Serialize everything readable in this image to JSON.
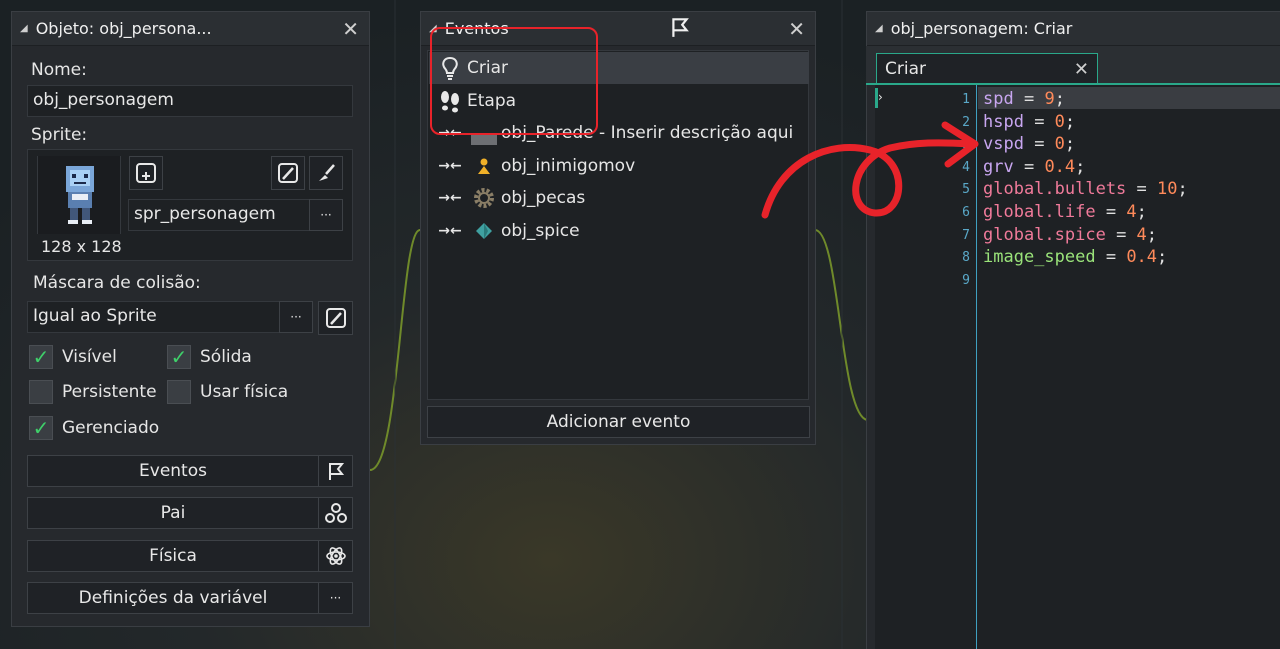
{
  "object_panel": {
    "title": "Objeto: obj_persona...",
    "name_label": "Nome:",
    "name_value": "obj_personagem",
    "sprite_label": "Sprite:",
    "sprite_name": "spr_personagem",
    "sprite_size": "128 x 128",
    "sprite_more": "···",
    "mask_label": "Máscara de colisão:",
    "mask_value": "Igual ao Sprite",
    "mask_more": "···",
    "checks": {
      "visible": {
        "label": "Visível",
        "checked": true
      },
      "solid": {
        "label": "Sólida",
        "checked": true
      },
      "persistent": {
        "label": "Persistente",
        "checked": false
      },
      "physics": {
        "label": "Usar física",
        "checked": false
      },
      "managed": {
        "label": "Gerenciado",
        "checked": true
      }
    },
    "buttons": {
      "events": "Eventos",
      "parent": "Pai",
      "physics": "Física",
      "variables": "Definições da variável",
      "variables_more": "···"
    }
  },
  "events_panel": {
    "title": "Eventos",
    "items": [
      {
        "label": "Criar",
        "icon": "lightbulb-icon"
      },
      {
        "label": "Etapa",
        "icon": "footsteps-icon"
      },
      {
        "label": "obj_Parede - Inserir descrição aqui",
        "icon": "collision-icon"
      },
      {
        "label": "obj_inimigomov",
        "icon": "collision-icon"
      },
      {
        "label": "obj_pecas",
        "icon": "collision-icon"
      },
      {
        "label": "obj_spice",
        "icon": "collision-icon"
      }
    ],
    "add_button": "Adicionar evento"
  },
  "code_panel": {
    "title": "obj_personagem: Criar",
    "tab": "Criar",
    "lines": [
      {
        "n": "1",
        "var": "spd",
        "op": " = ",
        "val": "9",
        "end": ";"
      },
      {
        "n": "2",
        "var": "hspd",
        "op": " = ",
        "val": "0",
        "end": ";"
      },
      {
        "n": "3",
        "var": "vspd",
        "op": " = ",
        "val": "0",
        "end": ";"
      },
      {
        "n": "4",
        "var": "grv",
        "op": " = ",
        "val": "0.4",
        "end": ";"
      },
      {
        "n": "5",
        "var": "global.bullets",
        "op": " = ",
        "val": "10",
        "end": ";"
      },
      {
        "n": "6",
        "var": "global.life",
        "op": " = ",
        "val": "4",
        "end": ";"
      },
      {
        "n": "7",
        "var": "global.spice",
        "op": " = ",
        "val": "4",
        "end": ";"
      },
      {
        "n": "8",
        "var": "image_speed",
        "op": " = ",
        "val": "0.4",
        "end": ";"
      },
      {
        "n": "9",
        "var": "",
        "op": "",
        "val": "",
        "end": ""
      }
    ]
  },
  "colors": {
    "annotation_red": "#e8232a",
    "check_green": "#3fd06a",
    "accent_teal": "#2aa88a"
  }
}
